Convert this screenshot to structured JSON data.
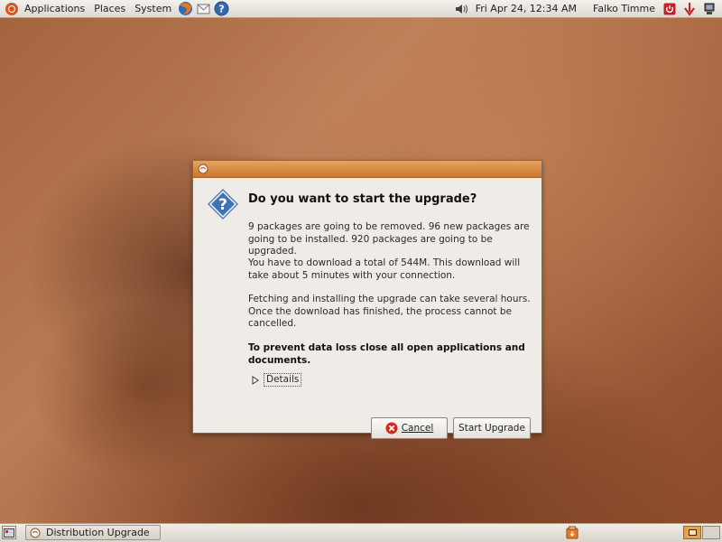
{
  "top_panel": {
    "menus": [
      "Applications",
      "Places",
      "System"
    ],
    "datetime": "Fri Apr 24, 12:34 AM",
    "user": "Falko Timme"
  },
  "dialog": {
    "heading": "Do you want to start the upgrade?",
    "paragraph_1": "9 packages are going to be removed. 96 new packages are going to be installed. 920 packages are going to be upgraded.",
    "paragraph_2": "You have to download a total of 544M. This download will take about 5 minutes with your connection.",
    "paragraph_3": "Fetching and installing the upgrade can take several hours. Once the download has finished, the process cannot be cancelled.",
    "warning": "To prevent data loss close all open applications and documents.",
    "details_label": "Details",
    "cancel_label": "Cancel",
    "start_label": "Start Upgrade"
  },
  "bottom_panel": {
    "task_label": "Distribution Upgrade"
  },
  "colors": {
    "titlebar_accent": "#d78a41",
    "dialog_bg": "#efebe6",
    "question_icon": "#3f73b3"
  },
  "icons": [
    "ubuntu-logo-icon",
    "firefox-icon",
    "mail-icon",
    "help-icon",
    "volume-icon",
    "power-icon",
    "network-icon",
    "question-icon",
    "cancel-icon",
    "update-icon"
  ]
}
